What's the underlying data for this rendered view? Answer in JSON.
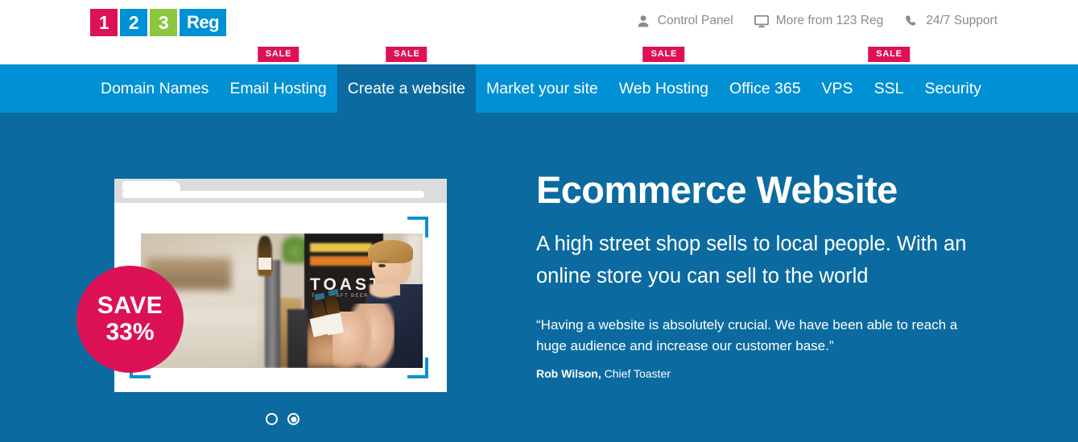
{
  "brand": {
    "logo_cells": [
      {
        "text": "1",
        "color": "#dd1155"
      },
      {
        "text": "2",
        "color": "#0090d4"
      },
      {
        "text": "3",
        "color": "#8cc63e"
      },
      {
        "text": "Reg",
        "color": "#0090d4"
      }
    ]
  },
  "topnav": {
    "items": [
      {
        "label": "Control Panel",
        "icon": "user-icon"
      },
      {
        "label": "More from 123 Reg",
        "icon": "monitor-icon"
      },
      {
        "label": "24/7 Support",
        "icon": "phone-icon"
      }
    ]
  },
  "mainnav": {
    "sale_label": "SALE",
    "items": [
      {
        "label": "Domain Names",
        "sale": false,
        "active": false
      },
      {
        "label": "Email Hosting",
        "sale": true,
        "active": false
      },
      {
        "label": "Create a website",
        "sale": true,
        "active": true
      },
      {
        "label": "Market your site",
        "sale": false,
        "active": false
      },
      {
        "label": "Web Hosting",
        "sale": true,
        "active": false
      },
      {
        "label": "Office 365",
        "sale": false,
        "active": false
      },
      {
        "label": "VPS",
        "sale": false,
        "active": false
      },
      {
        "label": "SSL",
        "sale": true,
        "active": false
      },
      {
        "label": "Security",
        "sale": false,
        "active": false
      }
    ]
  },
  "hero": {
    "save_badge": {
      "line1": "SAVE",
      "line2": "33%"
    },
    "title": "Ecommerce Website",
    "subtitle": "A high street shop sells to local people. With an online store you can sell to the world",
    "quote": "“Having a website is absolutely crucial. We have been able to reach a huge audience and increase our customer base.”",
    "attribution_name": "Rob Wilson,",
    "attribution_role": "Chief Toaster",
    "photo_sign_text": "TOAST",
    "photo_sign_subtext": "THE CRAFT BEER TOAST",
    "carousel": {
      "total": 2,
      "active_index": 1
    }
  },
  "colors": {
    "nav_blue": "#0090d4",
    "hero_blue": "#0b6ba0",
    "accent_crimson": "#dd1155",
    "accent_green": "#8cc63e",
    "bracket_blue": "#0f90d0"
  }
}
